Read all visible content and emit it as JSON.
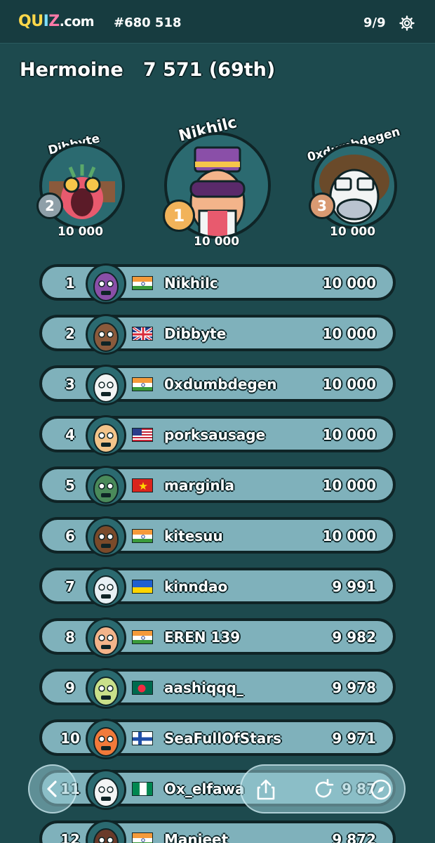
{
  "header": {
    "logo_parts": [
      "QU",
      "I",
      "Z",
      ".com"
    ],
    "game_id": "#680 518",
    "round": "9/9",
    "settings_icon": "gear-icon"
  },
  "player": {
    "name": "Hermoine",
    "score": "7 571",
    "rank": "(69th)"
  },
  "podium": [
    {
      "name": "Dibbyte",
      "medal": "2",
      "score": "10 000",
      "medal_color": "#8e9fa8"
    },
    {
      "name": "Nikhilc",
      "medal": "1",
      "score": "10 000",
      "medal_color": "#f2b35a"
    },
    {
      "name": "0xdumbdegen",
      "medal": "3",
      "score": "10 000",
      "medal_color": "#d99a72"
    }
  ],
  "leaderboard": [
    {
      "rank": "1",
      "name": "Nikhilc",
      "score": "10 000",
      "flag": "india"
    },
    {
      "rank": "2",
      "name": "Dibbyte",
      "score": "10 000",
      "flag": "uk"
    },
    {
      "rank": "3",
      "name": "0xdumbdegen",
      "score": "10 000",
      "flag": "india"
    },
    {
      "rank": "4",
      "name": "porksausage",
      "score": "10 000",
      "flag": "usa"
    },
    {
      "rank": "5",
      "name": "marginla",
      "score": "10 000",
      "flag": "vietnam"
    },
    {
      "rank": "6",
      "name": "kitesuu",
      "score": "10 000",
      "flag": "india"
    },
    {
      "rank": "7",
      "name": "kinndao",
      "score": "9 991",
      "flag": "ukraine"
    },
    {
      "rank": "8",
      "name": "EREN 139",
      "score": "9 982",
      "flag": "india"
    },
    {
      "rank": "9",
      "name": "aashiqqq_",
      "score": "9 978",
      "flag": "bangladesh"
    },
    {
      "rank": "10",
      "name": "SeaFullOfStars",
      "score": "9 971",
      "flag": "finland"
    },
    {
      "rank": "11",
      "name": "Ox_elfawa",
      "score": "9 87",
      "flag": "nigeria"
    },
    {
      "rank": "12",
      "name": "Manjeet",
      "score": "9 872",
      "flag": "india"
    }
  ],
  "floating": {
    "back_icon": "chevron-left-icon",
    "share_icon": "share-icon",
    "replay_icon": "replay-icon",
    "explore_icon": "compass-icon"
  },
  "colors": {
    "background": "#1d4a4e",
    "row": "#7fb1bb",
    "outline": "#0f2426"
  }
}
